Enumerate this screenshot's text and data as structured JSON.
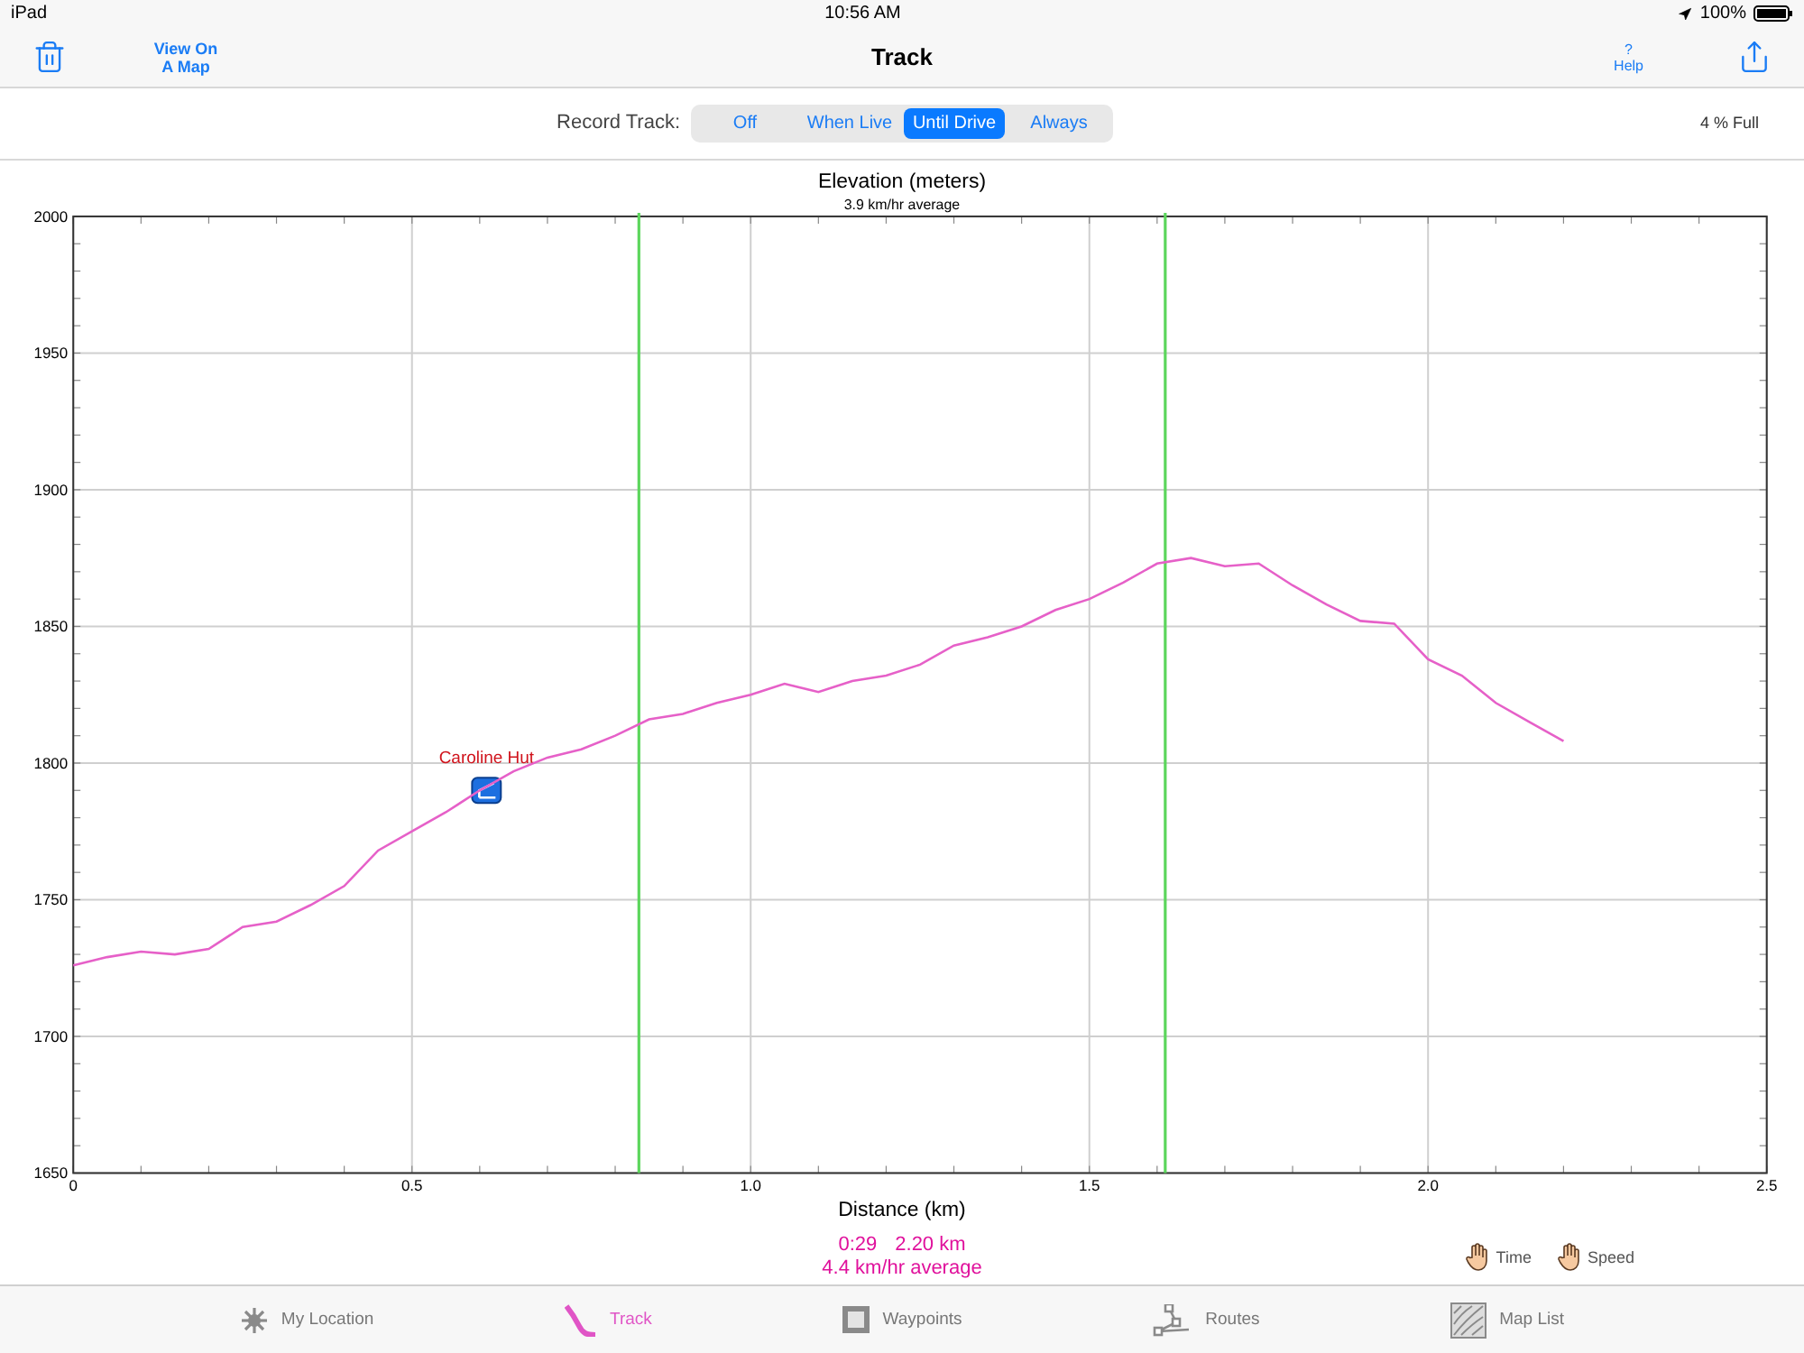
{
  "status_bar": {
    "device": "iPad",
    "time": "10:56 AM",
    "battery": "100%"
  },
  "nav": {
    "title": "Track",
    "map_button": "View On A Map",
    "help_mark": "?",
    "help_label": "Help"
  },
  "record": {
    "label": "Record Track:",
    "fullness": "4 % Full",
    "options": [
      {
        "label": "Off",
        "selected": false
      },
      {
        "label": "When Live",
        "selected": false
      },
      {
        "label": "Until Drive",
        "selected": true
      },
      {
        "label": "Always",
        "selected": false
      }
    ]
  },
  "chart": {
    "subtitle": "3.9 km/hr average",
    "chart_data": {
      "type": "line",
      "title": "Elevation (meters)",
      "xlabel": "Distance (km)",
      "xlim": [
        0,
        2.5
      ],
      "ylim": [
        1650,
        2000
      ],
      "xticks": [
        {
          "value": 0,
          "label": "0"
        },
        {
          "value": 0.5,
          "label": "0.5"
        },
        {
          "value": 1,
          "label": "1.0"
        },
        {
          "value": 1.5,
          "label": "1.5"
        },
        {
          "value": 2,
          "label": "2.0"
        },
        {
          "value": 2.5,
          "label": "2.5"
        }
      ],
      "yticks": [
        1650,
        1700,
        1750,
        1800,
        1850,
        1900,
        1950,
        2000
      ],
      "x": [
        0,
        0.05,
        0.1,
        0.15,
        0.2,
        0.25,
        0.3,
        0.35,
        0.4,
        0.45,
        0.5,
        0.55,
        0.6,
        0.65,
        0.7,
        0.75,
        0.8,
        0.85,
        0.9,
        0.95,
        1.0,
        1.05,
        1.1,
        1.15,
        1.2,
        1.25,
        1.3,
        1.35,
        1.4,
        1.45,
        1.5,
        1.55,
        1.6,
        1.65,
        1.7,
        1.75,
        1.8,
        1.85,
        1.9,
        1.95,
        2.0,
        2.05,
        2.1,
        2.15,
        2.2
      ],
      "series": [
        {
          "color": "#e660c8",
          "values": [
            1726,
            1729,
            1731,
            1730,
            1732,
            1740,
            1742,
            1748,
            1755,
            1768,
            1775,
            1782,
            1790,
            1797,
            1802,
            1805,
            1810,
            1816,
            1818,
            1822,
            1825,
            1829,
            1826,
            1830,
            1832,
            1836,
            1843,
            1846,
            1850,
            1856,
            1860,
            1866,
            1873,
            1875,
            1872,
            1873,
            1865,
            1858,
            1852,
            1851,
            1838,
            1832,
            1822,
            1815,
            1808
          ]
        }
      ],
      "grid": true,
      "ref_lines": [
        {
          "axis": "x",
          "value": 0.835,
          "color": "#5cd65c"
        },
        {
          "axis": "x",
          "value": 1.612,
          "color": "#5cd65c"
        }
      ],
      "annotations": [
        {
          "x": 0.61,
          "y": 1790,
          "text": "Caroline Hut"
        }
      ]
    }
  },
  "summary": {
    "time": "0:29",
    "distance": "2.20 km",
    "average": "4.4 km/hr average"
  },
  "modes": [
    {
      "label": "Time"
    },
    {
      "label": "Speed"
    }
  ],
  "tabs": [
    {
      "kind": "location",
      "label": "My Location",
      "selected": false
    },
    {
      "kind": "track",
      "label": "Track",
      "selected": true
    },
    {
      "kind": "waypoints",
      "label": "Waypoints",
      "selected": false
    },
    {
      "kind": "routes",
      "label": "Routes",
      "selected": false
    },
    {
      "kind": "maplist",
      "label": "Map List",
      "selected": false
    }
  ]
}
